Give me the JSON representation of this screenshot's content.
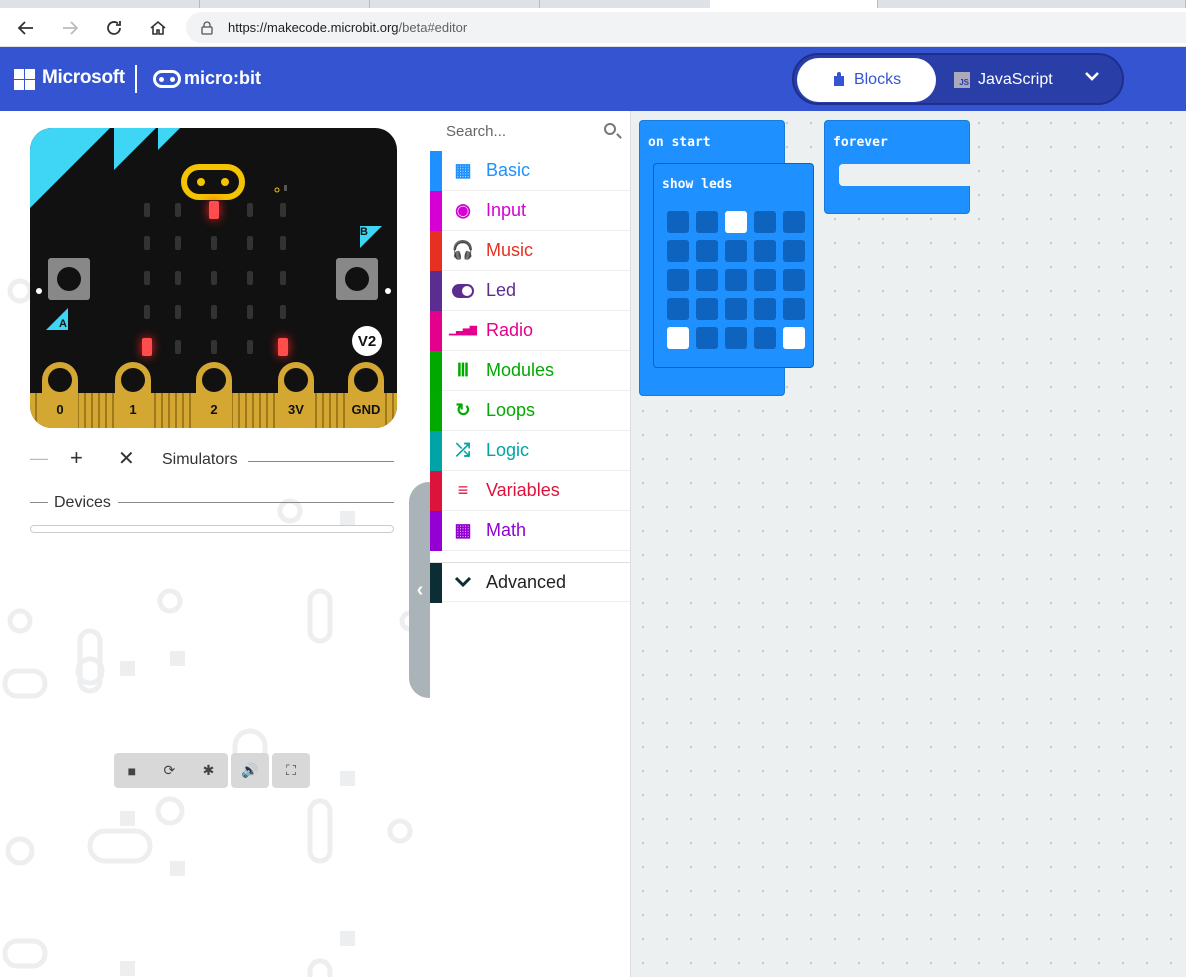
{
  "browser": {
    "url_host": "https://makecode.microbit.org",
    "url_path": "/beta#editor"
  },
  "header": {
    "brand": "Microsoft",
    "product": "micro:bit",
    "mode_blocks": "Blocks",
    "mode_js": "JavaScript",
    "js_icon_text": "JS"
  },
  "colors": {
    "header_bg": "#3454d1",
    "block_blue": "#1e90ff",
    "led_on": "#ff4d4d"
  },
  "simulator": {
    "pins": [
      "0",
      "1",
      "2",
      "3V",
      "GND"
    ],
    "button_a": "A",
    "button_b": "B",
    "version": "V2",
    "leds": [
      [
        0,
        0,
        1,
        0,
        0
      ],
      [
        0,
        0,
        0,
        0,
        0
      ],
      [
        0,
        0,
        0,
        0,
        0
      ],
      [
        0,
        0,
        0,
        0,
        0
      ],
      [
        1,
        0,
        0,
        0,
        1
      ]
    ],
    "simulators_label": "Simulators",
    "devices_label": "Devices"
  },
  "toolbox": {
    "search_placeholder": "Search...",
    "categories": [
      {
        "label": "Basic",
        "color": "#1e90ff",
        "icon": "grid-icon"
      },
      {
        "label": "Input",
        "color": "#d400d4",
        "icon": "target-icon"
      },
      {
        "label": "Music",
        "color": "#e63022",
        "icon": "headphones-icon"
      },
      {
        "label": "Led",
        "color": "#5c2d91",
        "icon": "toggle-icon"
      },
      {
        "label": "Radio",
        "color": "#e3008c",
        "icon": "signal-bars-icon"
      },
      {
        "label": "Modules",
        "color": "#00a800",
        "icon": "modules-icon"
      },
      {
        "label": "Loops",
        "color": "#00aa00",
        "icon": "refresh-icon"
      },
      {
        "label": "Logic",
        "color": "#00a4a6",
        "icon": "shuffle-icon"
      },
      {
        "label": "Variables",
        "color": "#dc143c",
        "icon": "lines-icon"
      },
      {
        "label": "Math",
        "color": "#9400d3",
        "icon": "calculator-icon"
      }
    ],
    "advanced": {
      "label": "Advanced",
      "color": "#0b2d34"
    }
  },
  "workspace": {
    "on_start_label": "on start",
    "show_leds_label": "show leds",
    "forever_label": "forever",
    "show_leds_grid": [
      [
        0,
        0,
        1,
        0,
        0
      ],
      [
        0,
        0,
        0,
        0,
        0
      ],
      [
        0,
        0,
        0,
        0,
        0
      ],
      [
        0,
        0,
        0,
        0,
        0
      ],
      [
        1,
        0,
        0,
        0,
        1
      ]
    ]
  }
}
